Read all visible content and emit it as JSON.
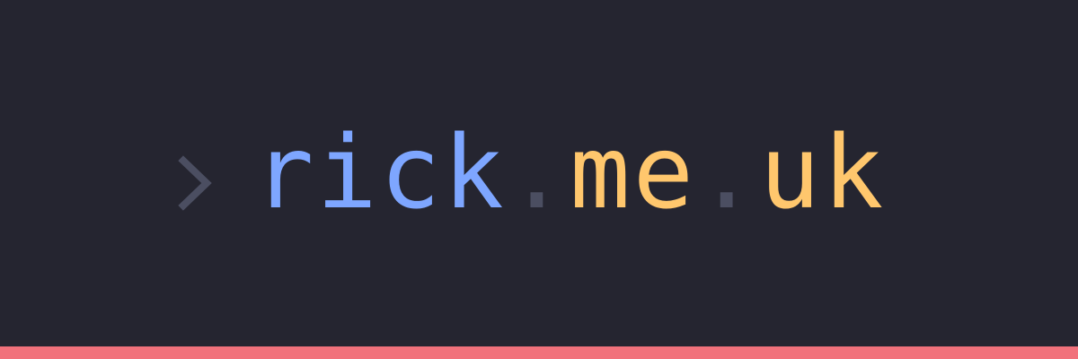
{
  "logo": {
    "prompt_icon": "chevron-right-icon",
    "parts": {
      "rick": "rick",
      "dot_1": ".",
      "me": "me",
      "dot_2": ".",
      "uk": "uk"
    }
  },
  "colors": {
    "background": "#252530",
    "prompt": "#4b4e61",
    "rick": "#7ea6ff",
    "dot": "#4b4e61",
    "domain": "#ffc76d",
    "accent_bar": "#f1717b"
  }
}
